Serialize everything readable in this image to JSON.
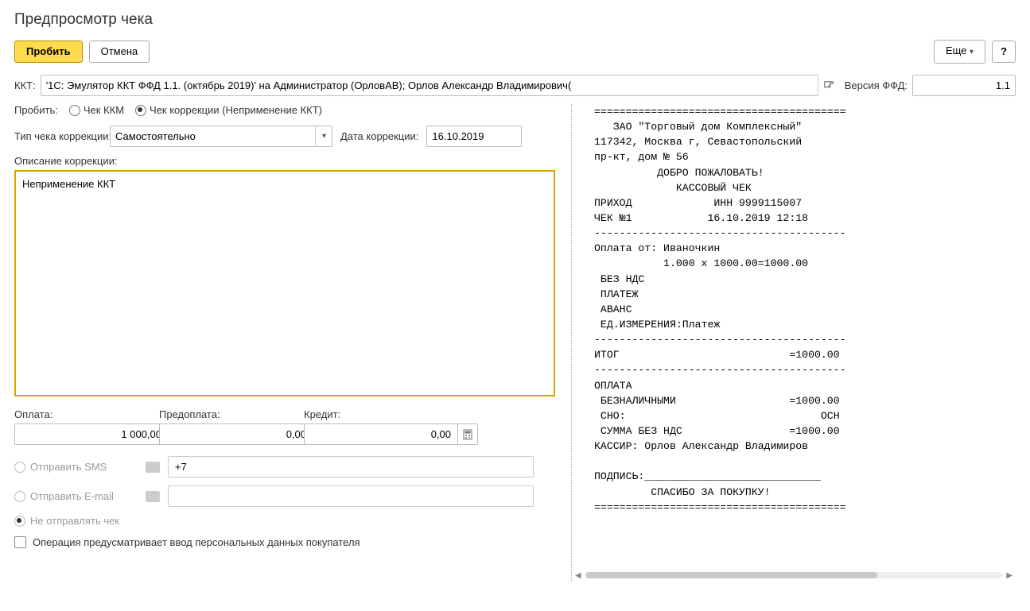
{
  "title": "Предпросмотр чека",
  "buttons": {
    "probit": "Пробить",
    "cancel": "Отмена",
    "more": "Еще",
    "help": "?"
  },
  "kkt": {
    "label": "ККТ:",
    "value": "'1С: Эмулятор ККТ ФФД 1.1. (октябрь 2019)' на Администратор (ОрловАВ); Орлов Александр Владимирович(",
    "version_label": "Версия ФФД:",
    "version_value": "1.1"
  },
  "punch": {
    "label": "Пробить:",
    "opt_kkm": "Чек ККМ",
    "opt_corr": "Чек коррекции (Неприменение ККТ)"
  },
  "corr": {
    "type_label": "Тип чека коррекции:",
    "type_value": "Самостоятельно",
    "date_label": "Дата коррекции:",
    "date_value": "16.10.2019",
    "desc_label": "Описание коррекции:",
    "desc_value": "Неприменение ККТ"
  },
  "amounts": {
    "pay_label": "Оплата:",
    "pay_value": "1 000,00",
    "prepay_label": "Предоплата:",
    "prepay_value": "0,00",
    "credit_label": "Кредит:",
    "credit_value": "0,00"
  },
  "send": {
    "sms_label": "Отправить SMS",
    "sms_value": "+7",
    "email_label": "Отправить E-mail",
    "none_label": "Не отправлять чек",
    "personal_data": "Операция предусматривает ввод персональных данных покупателя"
  },
  "receipt": "========================================\n   ЗАО \"Торговый дом Комплексный\"\n117342, Москва г, Севастопольский\nпр-кт, дом № 56\n          ДОБРО ПОЖАЛОВАТЬ!\n             КАССОВЫЙ ЧЕК\nПРИХОД             ИНН 9999115007\nЧЕК №1            16.10.2019 12:18\n----------------------------------------\nОплата от: Иваночкин\n           1.000 x 1000.00=1000.00\n БЕЗ НДС\n ПЛАТЕЖ\n АВАНС\n ЕД.ИЗМЕРЕНИЯ:Платеж\n----------------------------------------\nИТОГ                           =1000.00\n----------------------------------------\nОПЛАТА\n БЕЗНАЛИЧНЫМИ                  =1000.00\n СНО:                               ОСН\n СУММА БЕЗ НДС                 =1000.00\nКАССИР: Орлов Александр Владимиров\n\nПОДПИСЬ:____________________________\n         СПАСИБО ЗА ПОКУПКУ!\n========================================"
}
